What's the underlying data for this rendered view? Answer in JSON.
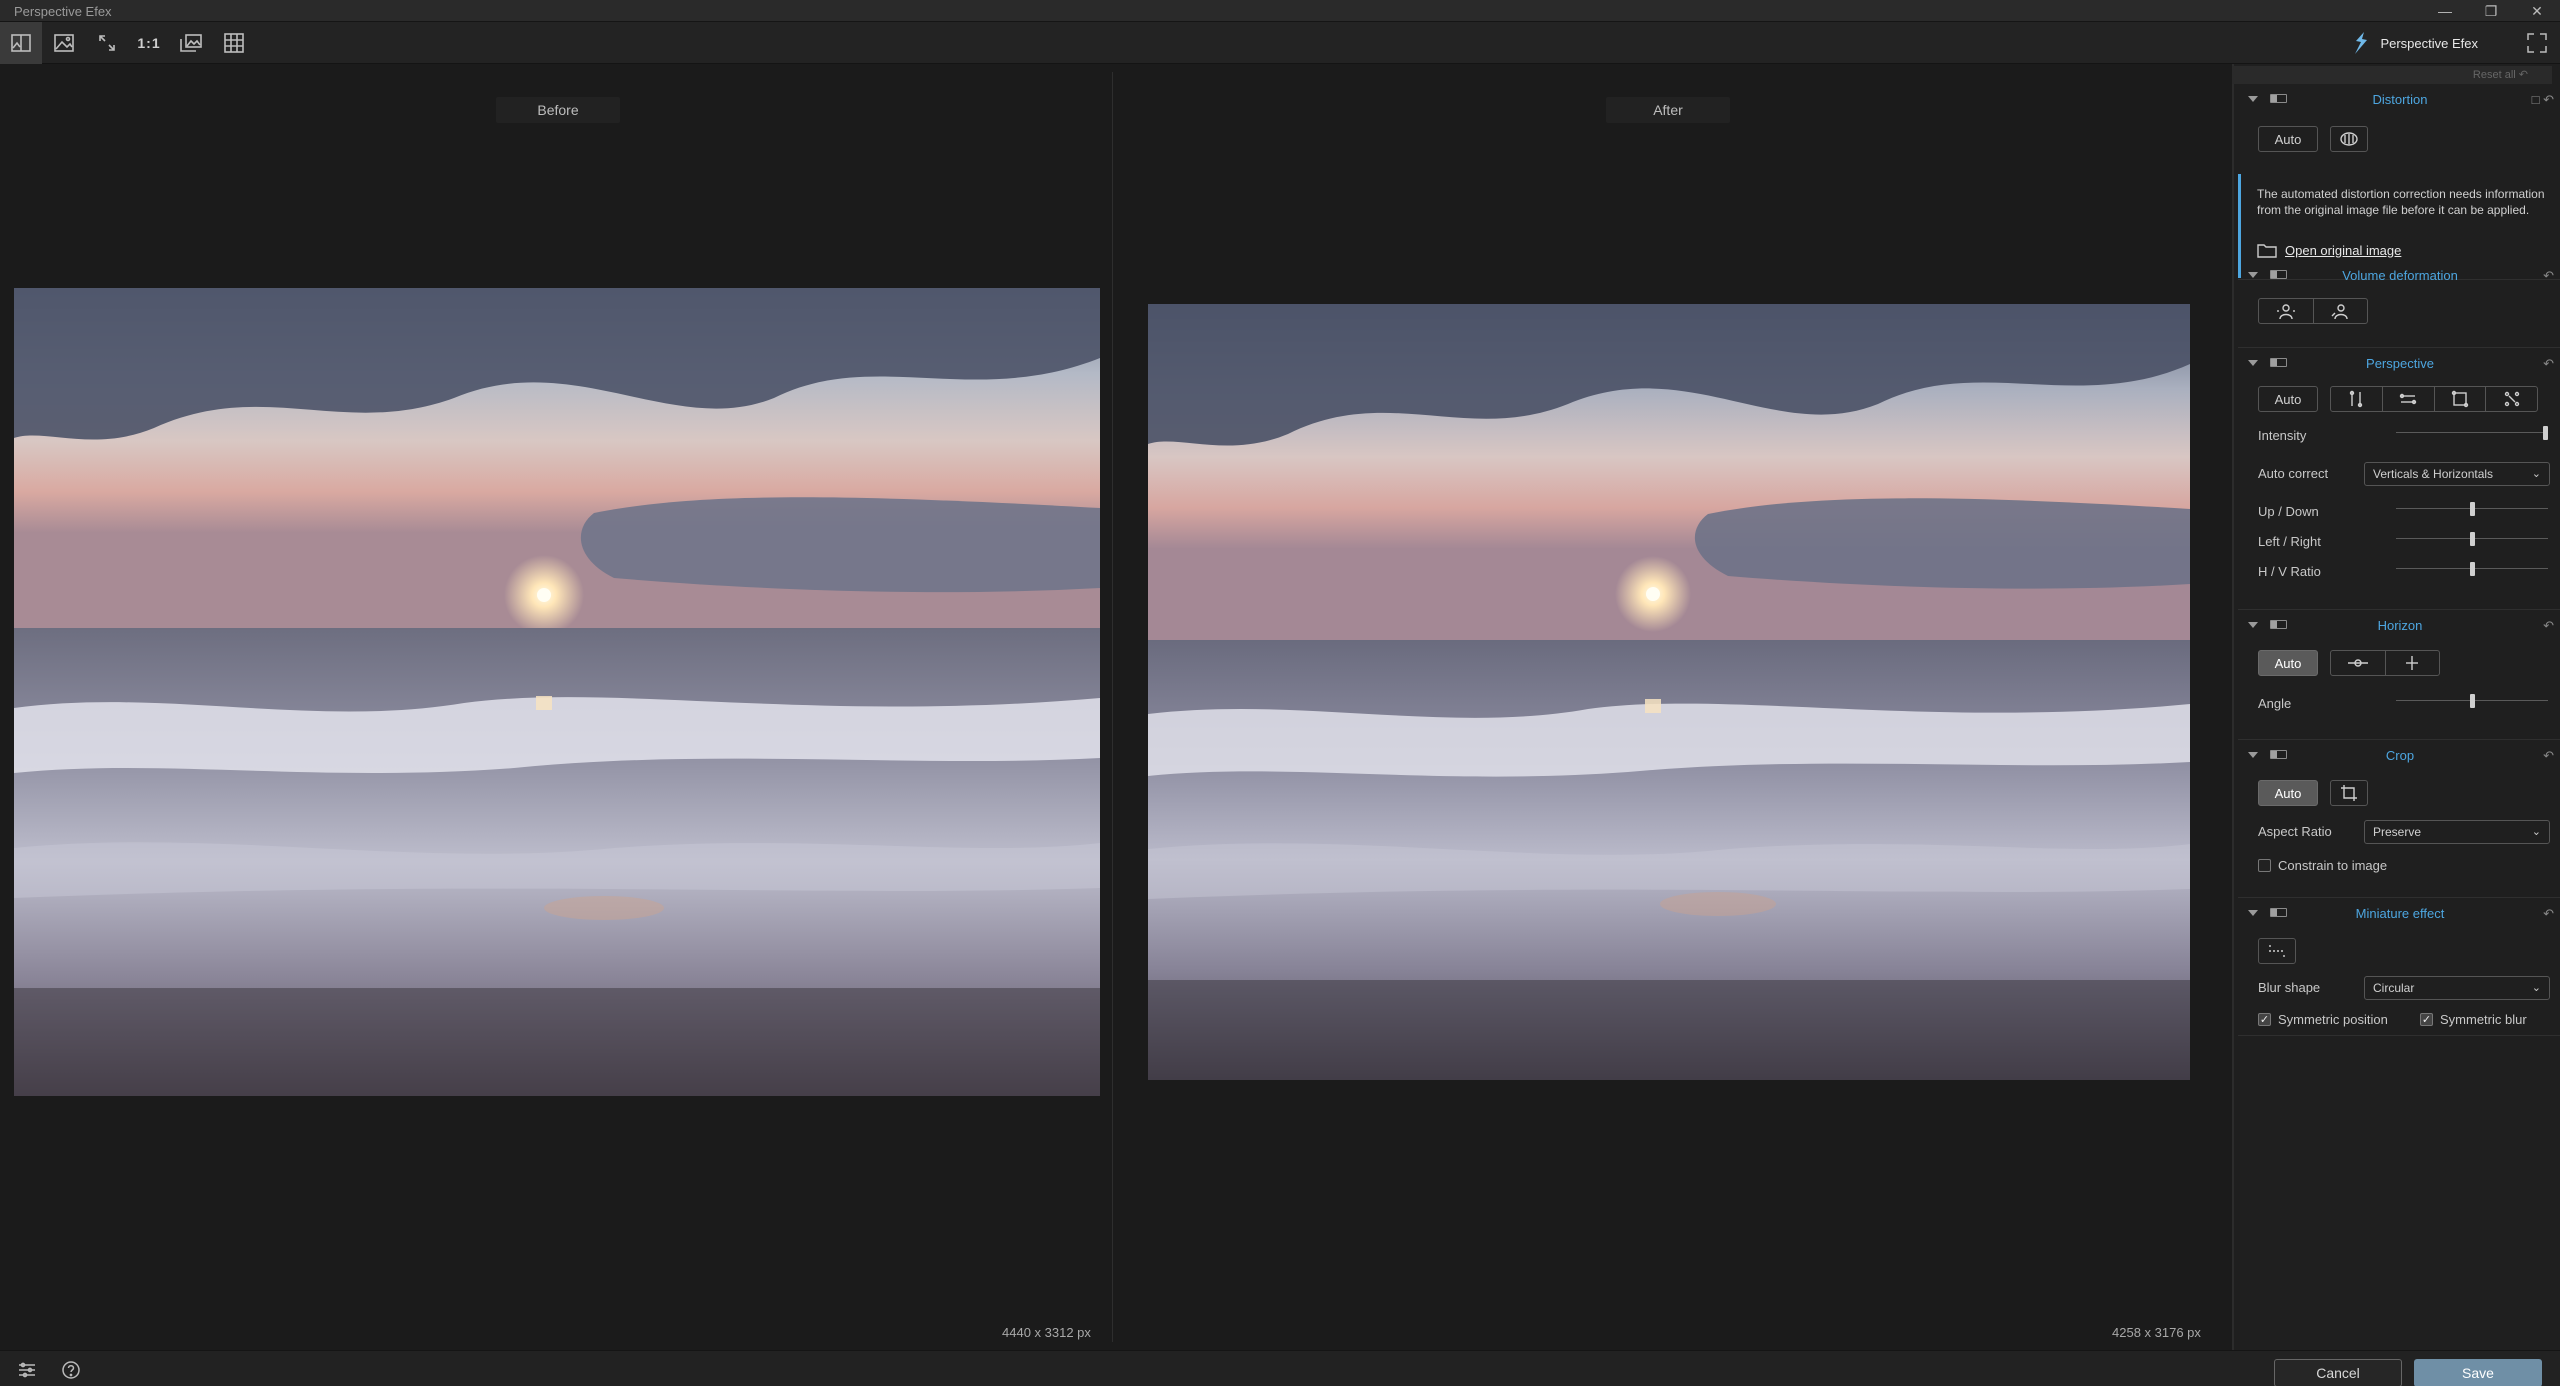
{
  "app": {
    "title": "Perspective Efex",
    "brand_name": "Perspective Efex",
    "window_controls": [
      "minimize",
      "restore",
      "close"
    ]
  },
  "toolbar": {
    "tools": [
      {
        "name": "split-view-icon",
        "active": true
      },
      {
        "name": "single-view-icon",
        "active": false
      },
      {
        "name": "fit-view-icon",
        "active": false
      },
      {
        "name": "zoom-1-1",
        "label": "1:1",
        "active": false
      },
      {
        "name": "compare-icon",
        "active": false
      },
      {
        "name": "grid-icon",
        "active": false
      }
    ]
  },
  "preview": {
    "before_label": "Before",
    "after_label": "After",
    "before_dims": "4440 x 3312 px",
    "after_dims": "4258 x 3176 px"
  },
  "panel": {
    "reset_all": "Reset all",
    "distortion": {
      "title": "Distortion",
      "auto_label": "Auto",
      "info_text": "The automated distortion correction needs information from the original image file before it can be applied.",
      "open_original_label": "Open original image"
    },
    "volume_deformation": {
      "title": "Volume deformation"
    },
    "perspective": {
      "title": "Perspective",
      "auto_label": "Auto",
      "intensity_label": "Intensity",
      "intensity_value": 1.0,
      "auto_correct_label": "Auto correct",
      "auto_correct_value": "Verticals & Horizontals",
      "up_down_label": "Up / Down",
      "up_down_value": 0.5,
      "left_right_label": "Left / Right",
      "left_right_value": 0.5,
      "hv_ratio_label": "H / V Ratio",
      "hv_ratio_value": 0.5
    },
    "horizon": {
      "title": "Horizon",
      "auto_label": "Auto",
      "auto_on": true,
      "angle_label": "Angle",
      "angle_value": 0.5
    },
    "crop": {
      "title": "Crop",
      "auto_label": "Auto",
      "auto_on": true,
      "aspect_ratio_label": "Aspect Ratio",
      "aspect_ratio_value": "Preserve",
      "constrain_label": "Constrain to image",
      "constrain_checked": false
    },
    "miniature": {
      "title": "Miniature effect",
      "blur_shape_label": "Blur shape",
      "blur_shape_value": "Circular",
      "symmetric_position_label": "Symmetric position",
      "symmetric_position_checked": true,
      "symmetric_blur_label": "Symmetric blur",
      "symmetric_blur_checked": true
    }
  },
  "footer": {
    "cancel_label": "Cancel",
    "save_label": "Save"
  },
  "colors": {
    "accent": "#4da6e0",
    "save_button": "#6f8fa6",
    "background": "#1c1c1c"
  }
}
